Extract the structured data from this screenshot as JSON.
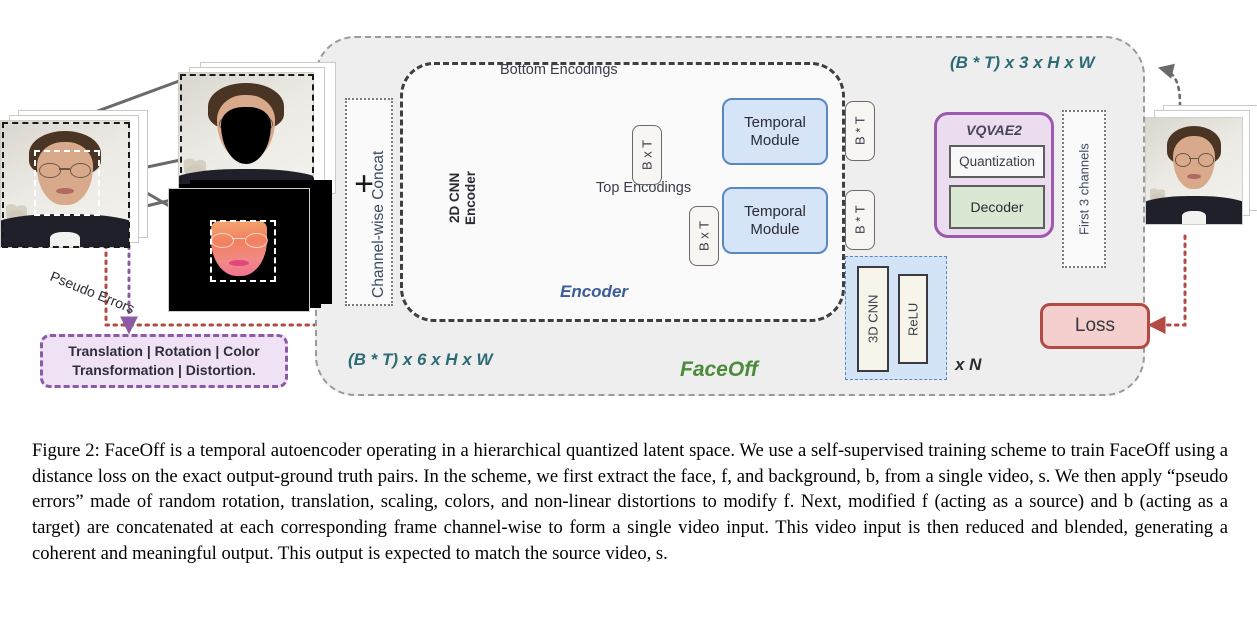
{
  "figure": {
    "panels": {
      "faceoff_label": "FaceOff",
      "encoder_label": "Encoder",
      "input_dim_label": "(B * T) x 6 x H x W",
      "output_dim_label": "(B * T) x 3 x H x W"
    },
    "concat": {
      "label": "Channel-wise Concat",
      "operator": "+"
    },
    "encoder": {
      "cnn_label_line1": "2D CNN",
      "cnn_label_line2": "Encoder",
      "bottom_encodings_label": "Bottom Encodings",
      "top_encodings_label": "Top Encodings",
      "bottom_tag": "B x T",
      "top_tag": "B x T"
    },
    "temporal_modules": [
      {
        "line1": "Temporal",
        "line2": "Module",
        "tag": "B * T"
      },
      {
        "line1": "Temporal",
        "line2": "Module",
        "tag": "B * T"
      }
    ],
    "residual_block": {
      "cell_1": "3D CNN",
      "cell_2": "ReLU",
      "repeat_label": "x N"
    },
    "vqvae": {
      "title": "VQVAE2",
      "quantization_label": "Quantization",
      "decoder_label": "Decoder"
    },
    "first_channels_label": "First 3 channels",
    "loss_label": "Loss",
    "pseudo_errors_label": "Pseudo Errors",
    "pseudo_errors_box_line1": "Translation | Rotation | Color",
    "pseudo_errors_box_line2": "Transformation | Distortion.",
    "colors": {
      "panel_bg": "#eeeeee",
      "encoder_bg": "#fafafa",
      "dim_text": "#2c6b75",
      "faceoff_text": "#4b8b3b",
      "encoder_text": "#3a5c9a",
      "temporal_fill": "#d6e4f7",
      "temporal_stroke": "#5b86c4",
      "bottom_cube": "#c3cfe8",
      "top_cube": "#c9dcc0",
      "vqvae_fill": "#ecdcef",
      "vqvae_stroke": "#9c59ad",
      "decoder_fill": "#d9e8d2",
      "loss_fill": "#f4cfcd",
      "loss_stroke": "#b44a44",
      "pseudo_fill": "#efe2f4",
      "pseudo_stroke": "#8b5ba8",
      "loss_arrow": "#b44a44",
      "pseudo_arrow": "#8b5ba8"
    }
  },
  "caption": {
    "number": "Figure 2:",
    "text": " FaceOff is a temporal autoencoder operating in a hierarchical quantized latent space. We use a self-supervised training scheme to train FaceOff using a distance loss on the exact output-ground truth pairs. In the scheme, we first extract the face, f, and background, b, from a single video, s. We then apply “pseudo errors” made of random rotation, translation, scaling, colors, and non-linear distortions to modify f. Next, modified f (acting as a source) and b (acting as a target) are concatenated at each corresponding frame channel-wise to form a single video input. This video input is then reduced and blended, generating a coherent and meaningful output. This output is expected to match the source video, s."
  }
}
